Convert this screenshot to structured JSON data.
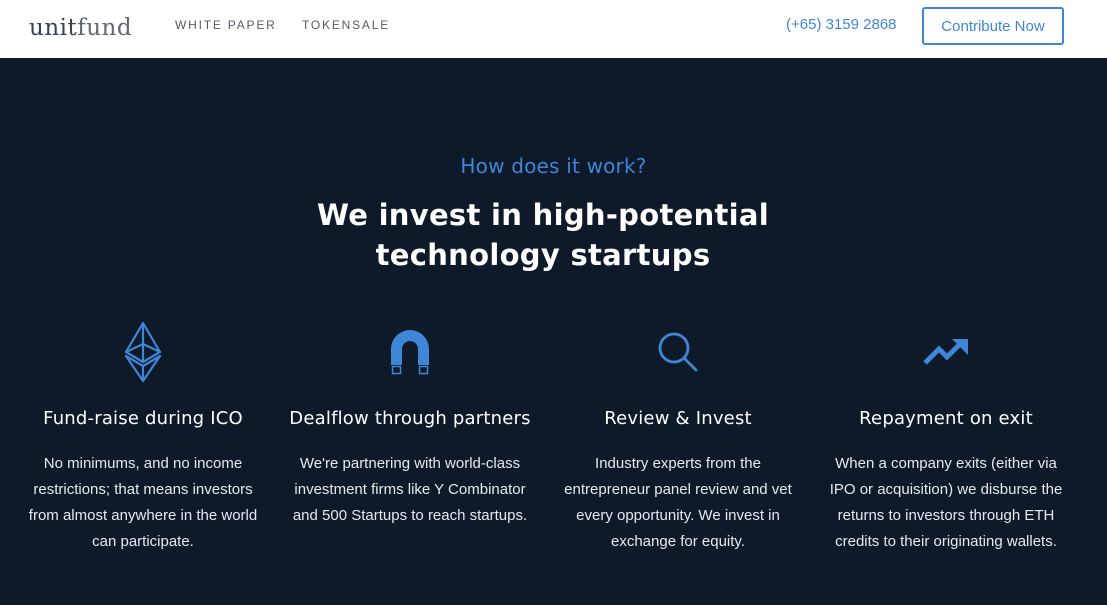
{
  "brand": {
    "logo_a": "unit",
    "logo_b": "fund"
  },
  "nav": {
    "white_paper": "WHITE PAPER",
    "tokensale": "TOKENSALE"
  },
  "contact": {
    "phone": "(+65) 3159 2868",
    "cta": "Contribute Now"
  },
  "section": {
    "eyebrow": "How does it work?",
    "headline": "We invest in high-potential technology startups"
  },
  "features": [
    {
      "icon": "ethereum-icon",
      "title": "Fund-raise during ICO",
      "text": "No minimums, and no income restrictions; that means investors from almost anywhere in the world can participate."
    },
    {
      "icon": "magnet-icon",
      "title": "Dealflow through partners",
      "text": "We're partnering with world-class investment firms like Y Combinator and 500 Startups to reach startups."
    },
    {
      "icon": "search-icon",
      "title": "Review & Invest",
      "text": "Industry experts from the entrepreneur panel review and vet every opportunity. We invest in exchange for equity."
    },
    {
      "icon": "trending-up-icon",
      "title": "Repayment on exit",
      "text": "When a company exits (either via IPO or acquisition) we disburse the returns to investors through ETH credits to their originating wallets."
    }
  ],
  "colors": {
    "accent": "#3f86d6",
    "background": "#0e1a29",
    "navbar": "#ffffff"
  }
}
